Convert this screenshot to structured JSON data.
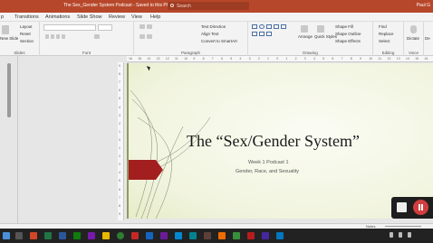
{
  "window": {
    "title": "The Sex_Gender System Podcast - Saved to this PC",
    "search_placeholder": "Search",
    "user": "Paul G"
  },
  "tabs": [
    "p",
    "Transitions",
    "Animations",
    "Slide Show",
    "Review",
    "View",
    "Help"
  ],
  "ribbon": {
    "slides": {
      "new_slide": "New Slide",
      "layout": "Layout",
      "reset": "Reset",
      "section": "Section",
      "label": "Slides"
    },
    "font": {
      "label": "Font"
    },
    "paragraph": {
      "text_direction": "Text Direction",
      "align_text": "Align Text",
      "smartart": "Convert to SmartArt",
      "label": "Paragraph"
    },
    "drawing": {
      "arrange": "Arrange",
      "quick_styles": "Quick Styles",
      "shape_fill": "Shape Fill",
      "shape_outline": "Shape Outline",
      "shape_effects": "Shape Effects",
      "label": "Drawing"
    },
    "editing": {
      "find": "Find",
      "replace": "Replace",
      "select": "Select",
      "label": "Editing"
    },
    "voice": {
      "dictate": "Dictate",
      "label": "Voice"
    },
    "designer": {
      "design_ideas": "De"
    }
  },
  "ruler_ticks": [
    "16",
    "15",
    "14",
    "13",
    "12",
    "11",
    "10",
    "9",
    "8",
    "7",
    "6",
    "5",
    "4",
    "3",
    "2",
    "1",
    "0",
    "1",
    "2",
    "3",
    "4",
    "5",
    "6",
    "7",
    "8",
    "9",
    "10",
    "11",
    "12",
    "13",
    "14",
    "15",
    "16"
  ],
  "vruler_ticks": [
    "9",
    "8",
    "7",
    "6",
    "5",
    "4",
    "3",
    "2",
    "1",
    "0",
    "1",
    "2",
    "3",
    "4",
    "5",
    "6",
    "7",
    "8",
    "9"
  ],
  "slide": {
    "title": "The “Sex/Gender System”",
    "subtitle_line1": "Week 1 Podcast 1",
    "subtitle_line2": "Gender, Race, and Sexuality",
    "accent_color": "#a31f1f",
    "background_color": "#f3f5e2"
  },
  "status": {
    "notes": "Notes"
  },
  "recorder": {
    "pause_color": "#d23d3d"
  }
}
